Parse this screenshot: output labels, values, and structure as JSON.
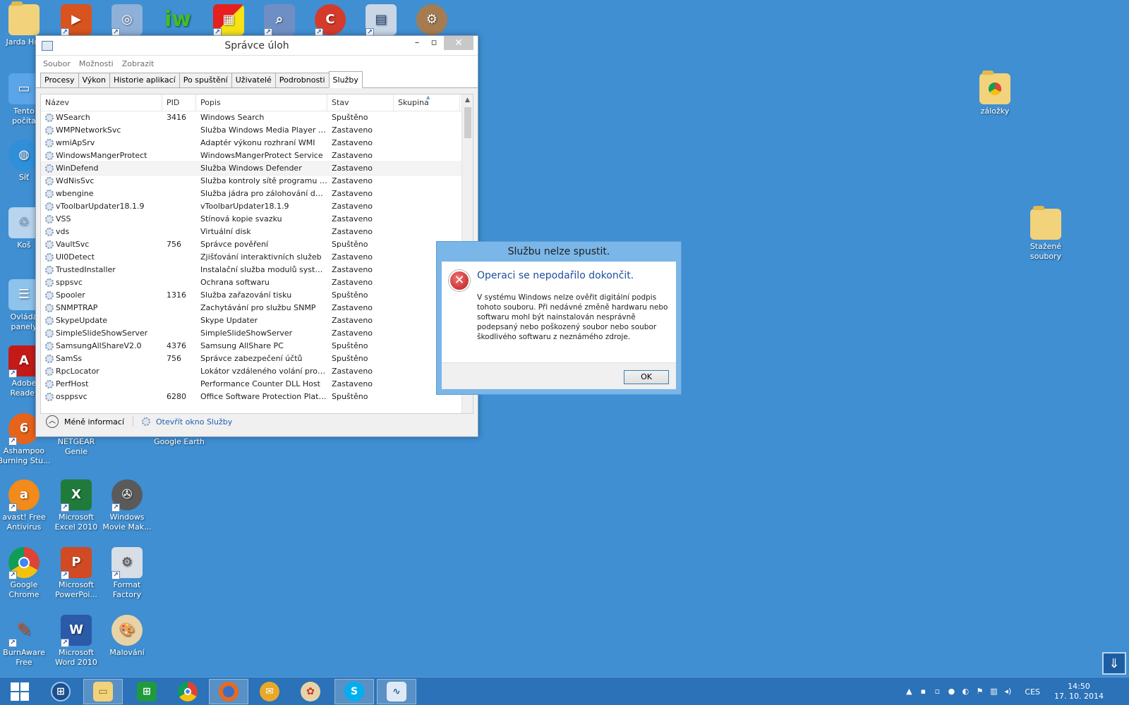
{
  "desktop": {
    "top_labels": {
      "user": "Jarda Hra"
    },
    "left_icons": {
      "computer": [
        "Tento",
        "počíta"
      ],
      "network": "Síť",
      "recycle": "Koš",
      "control": [
        "Ovládá",
        "panely"
      ],
      "adobe": [
        "Adobe",
        "Reader"
      ],
      "ashampoo": [
        "Ashampoo",
        "Burning Stu..."
      ],
      "netgear": [
        "NETGEAR",
        "Genie"
      ],
      "earth": "Google Earth",
      "avast": [
        "avast! Free",
        "Antivirus"
      ],
      "excel": [
        "Microsoft",
        "Excel 2010"
      ],
      "moviemaker": [
        "Windows",
        "Movie Mak..."
      ],
      "chrome": [
        "Google",
        "Chrome"
      ],
      "powerpoint": [
        "Microsoft",
        "PowerPoi..."
      ],
      "format": [
        "Format",
        "Factory"
      ],
      "burnaware": [
        "BurnAware",
        "Free"
      ],
      "word": [
        "Microsoft",
        "Word 2010"
      ],
      "paint": "Malování"
    },
    "right_icons": {
      "zalozky": "záložky",
      "stazene": [
        "Stažené",
        "soubory"
      ]
    }
  },
  "task_manager": {
    "title": "Správce úloh",
    "menu": [
      "Soubor",
      "Možnosti",
      "Zobrazit"
    ],
    "tabs": [
      "Procesy",
      "Výkon",
      "Historie aplikací",
      "Po spuštění",
      "Uživatelé",
      "Podrobnosti",
      "Služby"
    ],
    "active_tab": "Služby",
    "columns": [
      "Název",
      "PID",
      "Popis",
      "Stav",
      "Skupina"
    ],
    "rows": [
      {
        "name": "WSearch",
        "pid": "3416",
        "desc": "Windows Search",
        "state": "Spuštěno"
      },
      {
        "name": "WMPNetworkSvc",
        "pid": "",
        "desc": "Služba Windows Media Player N...",
        "state": "Zastaveno"
      },
      {
        "name": "wmiApSrv",
        "pid": "",
        "desc": "Adaptér výkonu rozhraní WMI",
        "state": "Zastaveno"
      },
      {
        "name": "WindowsMangerProtect",
        "pid": "",
        "desc": "WindowsMangerProtect Service",
        "state": "Zastaveno"
      },
      {
        "name": "WinDefend",
        "pid": "",
        "desc": "Služba Windows Defender",
        "state": "Zastaveno"
      },
      {
        "name": "WdNisSvc",
        "pid": "",
        "desc": "Služba kontroly sítě programu W...",
        "state": "Zastaveno"
      },
      {
        "name": "wbengine",
        "pid": "",
        "desc": "Služba jádra pro zálohování dat ...",
        "state": "Zastaveno"
      },
      {
        "name": "vToolbarUpdater18.1.9",
        "pid": "",
        "desc": "vToolbarUpdater18.1.9",
        "state": "Zastaveno"
      },
      {
        "name": "VSS",
        "pid": "",
        "desc": "Stínová kopie svazku",
        "state": "Zastaveno"
      },
      {
        "name": "vds",
        "pid": "",
        "desc": "Virtuální disk",
        "state": "Zastaveno"
      },
      {
        "name": "VaultSvc",
        "pid": "756",
        "desc": "Správce pověření",
        "state": "Spuštěno"
      },
      {
        "name": "UI0Detect",
        "pid": "",
        "desc": "Zjišťování interaktivních služeb",
        "state": "Zastaveno"
      },
      {
        "name": "TrustedInstaller",
        "pid": "",
        "desc": "Instalační služba modulů systém...",
        "state": "Zastaveno"
      },
      {
        "name": "sppsvc",
        "pid": "",
        "desc": "Ochrana softwaru",
        "state": "Zastaveno"
      },
      {
        "name": "Spooler",
        "pid": "1316",
        "desc": "Služba zařazování tisku",
        "state": "Spuštěno"
      },
      {
        "name": "SNMPTRAP",
        "pid": "",
        "desc": "Zachytávání pro službu SNMP",
        "state": "Zastaveno"
      },
      {
        "name": "SkypeUpdate",
        "pid": "",
        "desc": "Skype Updater",
        "state": "Zastaveno"
      },
      {
        "name": "SimpleSlideShowServer",
        "pid": "",
        "desc": "SimpleSlideShowServer",
        "state": "Zastaveno"
      },
      {
        "name": "SamsungAllShareV2.0",
        "pid": "4376",
        "desc": "Samsung AllShare PC",
        "state": "Spuštěno"
      },
      {
        "name": "SamSs",
        "pid": "756",
        "desc": "Správce zabezpečení účtů",
        "state": "Spuštěno"
      },
      {
        "name": "RpcLocator",
        "pid": "",
        "desc": "Lokátor vzdáleného volání proce...",
        "state": "Zastaveno"
      },
      {
        "name": "PerfHost",
        "pid": "",
        "desc": "Performance Counter DLL Host",
        "state": "Zastaveno"
      },
      {
        "name": "osppsvc",
        "pid": "6280",
        "desc": "Office Software Protection Platfo...",
        "state": "Spuštěno"
      }
    ],
    "selected_row": 4,
    "footer": {
      "less_info": "Méně informací",
      "open_services": "Otevřít okno Služby"
    }
  },
  "dialog": {
    "title": "Službu nelze spustit.",
    "heading": "Operaci se nepodařilo dokončit.",
    "message": "V systému Windows nelze ověřit digitální podpis tohoto souboru. Při nedávné změně hardwaru nebo softwaru mohl být nainstalován nesprávně podepsaný nebo poškozený soubor nebo soubor škodlivého softwaru z neznámého zdroje.",
    "ok": "OK"
  },
  "taskbar": {
    "language": "CES",
    "time": "14:50",
    "date": "17. 10. 2014"
  }
}
